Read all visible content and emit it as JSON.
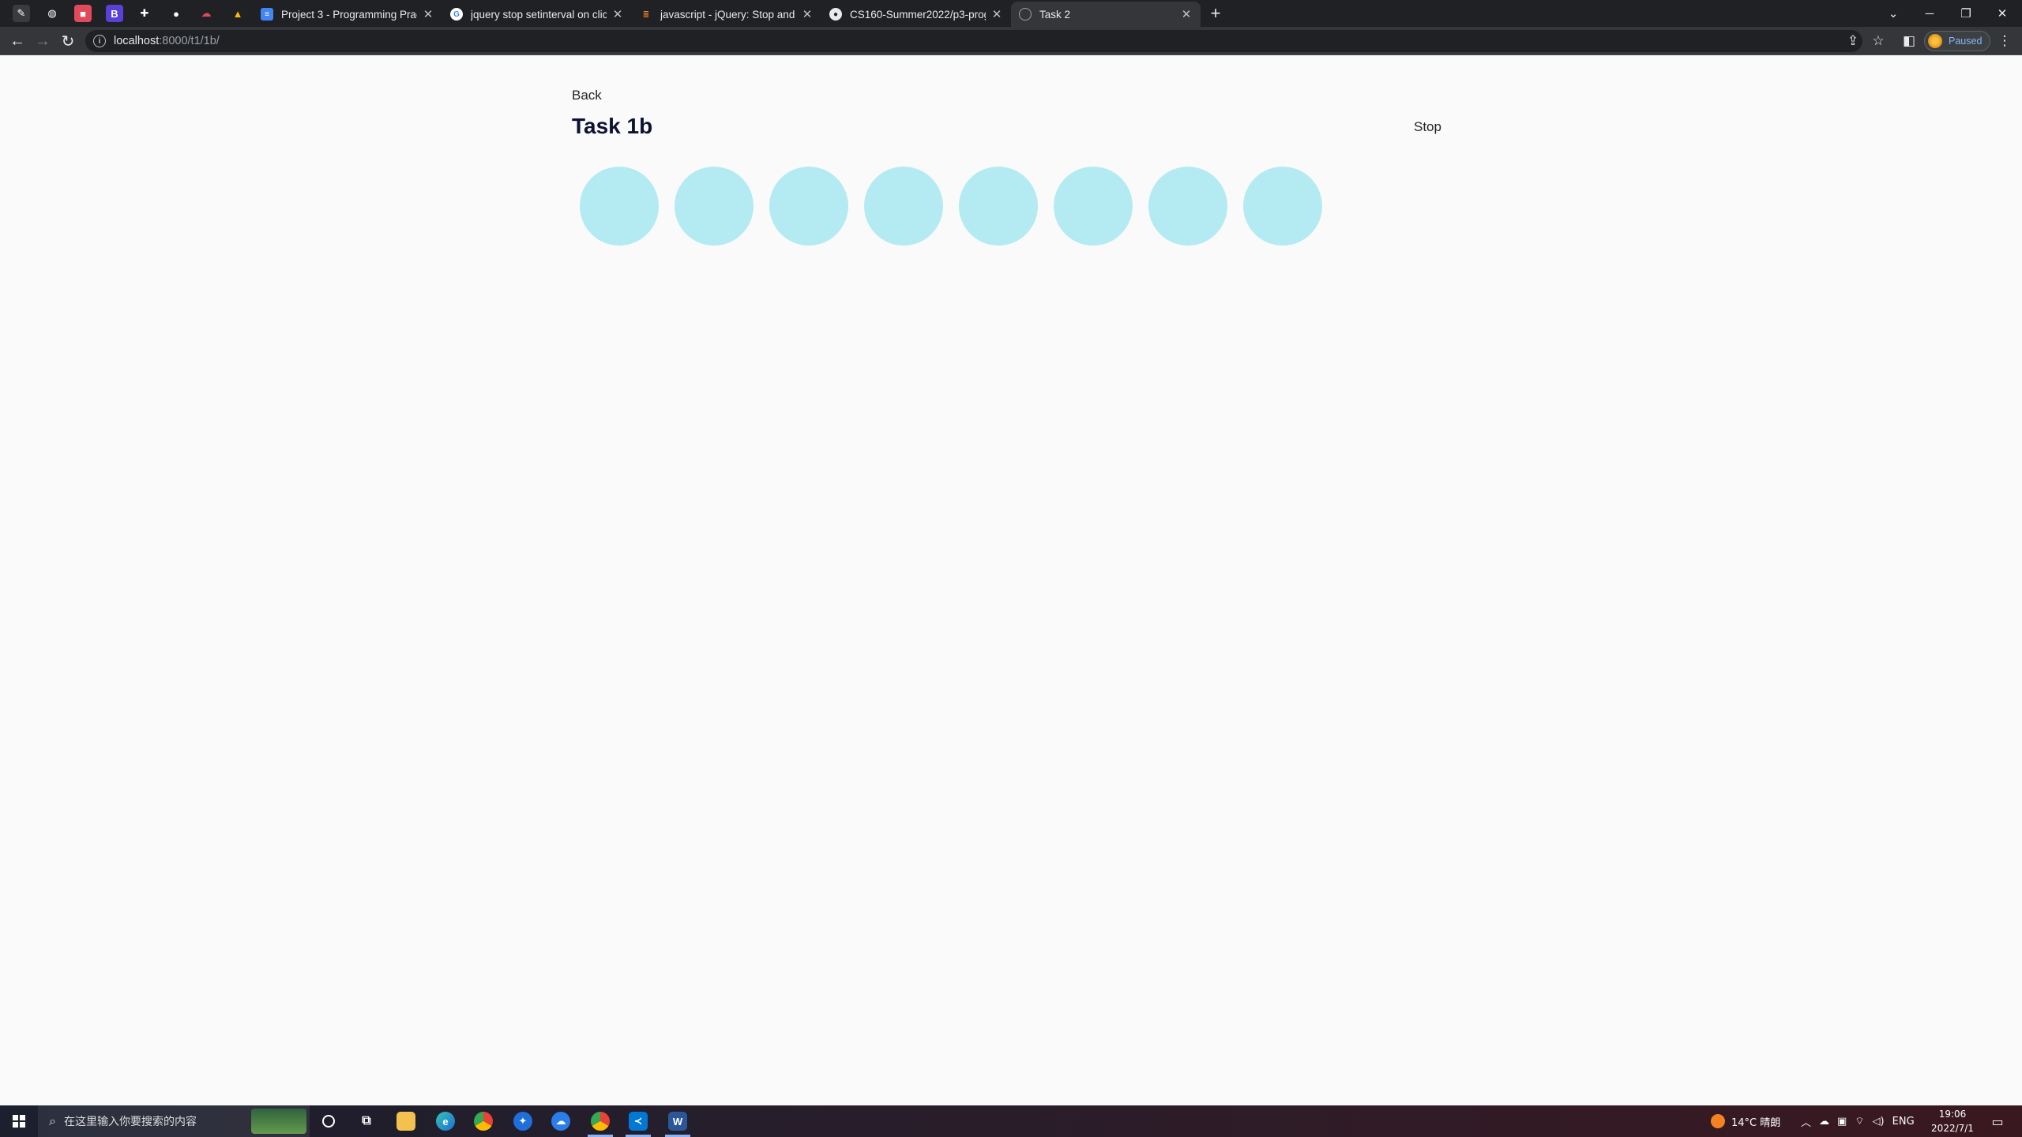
{
  "browser": {
    "tabs": [
      {
        "title": "Project 3 - Programming Pract",
        "favicon": "google-docs-icon"
      },
      {
        "title": "jquery stop setinterval on click",
        "favicon": "google-icon"
      },
      {
        "title": "javascript - jQuery: Stop and s",
        "favicon": "stackoverflow-icon"
      },
      {
        "title": "CS160-Summer2022/p3-prog",
        "favicon": "github-icon"
      },
      {
        "title": "Task 2",
        "favicon": "globe-icon"
      }
    ],
    "address": {
      "host": "localhost",
      "path": ":8000/t1/1b/"
    },
    "profile_label": "Paused"
  },
  "page": {
    "back_label": "Back",
    "title": "Task 1b",
    "stop_label": "Stop",
    "circle_color": "#b4ebf2",
    "circle_count": 8
  },
  "taskbar": {
    "search_placeholder": "在这里输入你要搜索的内容",
    "weather": "14°C 晴朗",
    "language": "ENG",
    "time": "19:06",
    "date": "2022/7/1"
  }
}
